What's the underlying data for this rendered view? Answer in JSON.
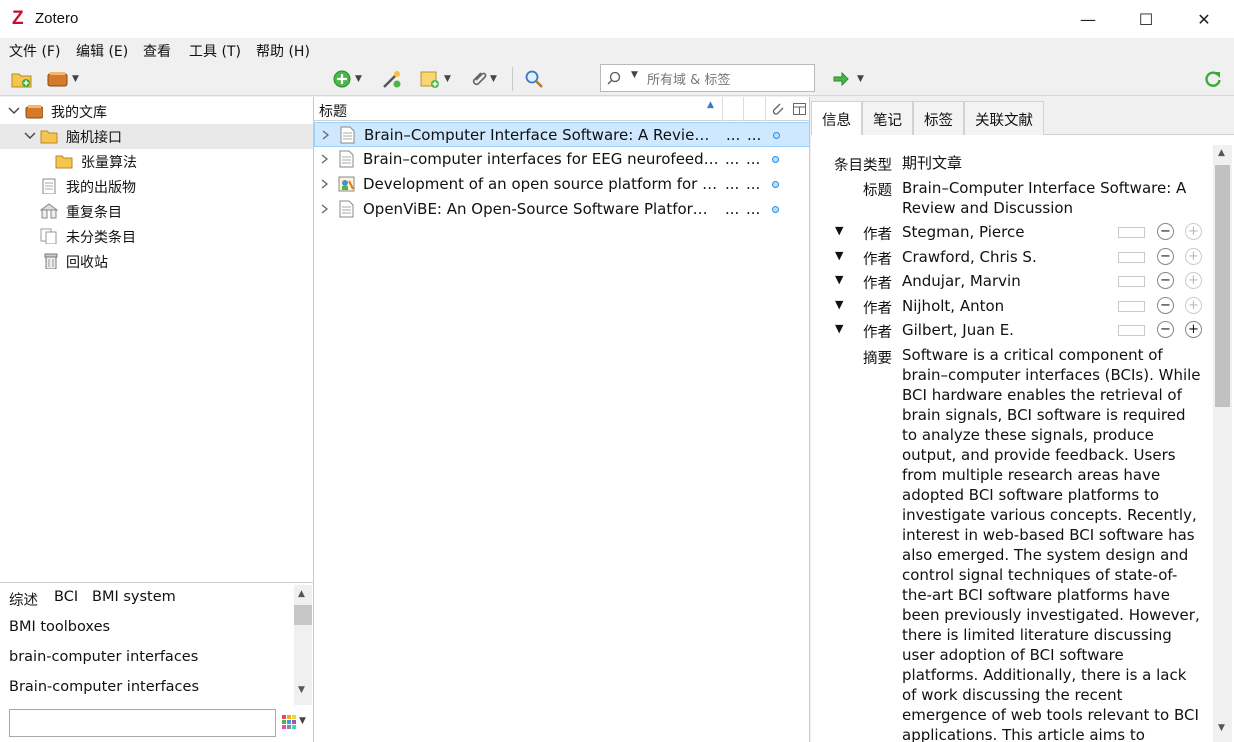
{
  "window": {
    "app_title": "Zotero",
    "logo_letter": "Z",
    "minimize": "—",
    "maximize": "☐",
    "close": "✕"
  },
  "menu": [
    "文件 (F)",
    "编辑 (E)",
    "查看",
    "工具 (T)",
    "帮助 (H)"
  ],
  "toolbar": {
    "search_placeholder": "所有域 & 标签"
  },
  "collections": [
    {
      "label": "我的文库",
      "icon": "library-icon"
    },
    {
      "label": "脑机接口",
      "icon": "folder-icon"
    },
    {
      "label": "张量算法",
      "icon": "folder-icon"
    },
    {
      "label": "我的出版物",
      "icon": "publications-icon"
    },
    {
      "label": "重复条目",
      "icon": "duplicates-icon"
    },
    {
      "label": "未分类条目",
      "icon": "unfiled-icon"
    },
    {
      "label": "回收站",
      "icon": "trash-icon"
    }
  ],
  "tags": [
    "综述",
    "BCI",
    "BMI system",
    "BMI toolboxes",
    "brain-computer interfaces",
    "Brain-computer interfaces"
  ],
  "items_header": {
    "title": "标题"
  },
  "items": [
    {
      "title": "Brain–Computer Interface Software: A Review and Discussion",
      "c1": "...",
      "c2": "..."
    },
    {
      "title": "Brain–computer interfaces for EEG neurofeedback",
      "c1": "...",
      "c2": "..."
    },
    {
      "title": "Development of an open source platform for brain–computer interfaces",
      "c1": "...",
      "c2": "..."
    },
    {
      "title": "OpenViBE: An Open-Source Software Platform to Design, Test, and Use BCIs",
      "c1": "...",
      "c2": "..."
    }
  ],
  "tabs": [
    "信息",
    "笔记",
    "标签",
    "关联文献"
  ],
  "info": {
    "item_type_label": "条目类型",
    "item_type": "期刊文章",
    "title_label": "标题",
    "title": "Brain–Computer Interface Software: A Review and Discussion",
    "author_label": "作者",
    "authors": [
      "Stegman, Pierce",
      "Crawford, Chris S.",
      "Andujar, Marvin",
      "Nijholt, Anton",
      "Gilbert, Juan E."
    ],
    "abstract_label": "摘要",
    "abstract": "Software is a critical component of brain–computer interfaces (BCIs). While BCI hardware enables the retrieval of brain signals, BCI software is required to analyze these signals, produce output, and provide feedback. Users from multiple research areas have adopted BCI software platforms to investigate various concepts. Recently, interest in web-based BCI software has also emerged. The system design and control signal techniques of state-of-the-art BCI software platforms have been previously investigated. However, there is limited literature discussing user adoption of BCI software platforms. Additionally, there is a lack of work discussing the recent emergence of web tools relevant to BCI applications. This article aims to address these gaps by presenting a bibliometric"
  }
}
